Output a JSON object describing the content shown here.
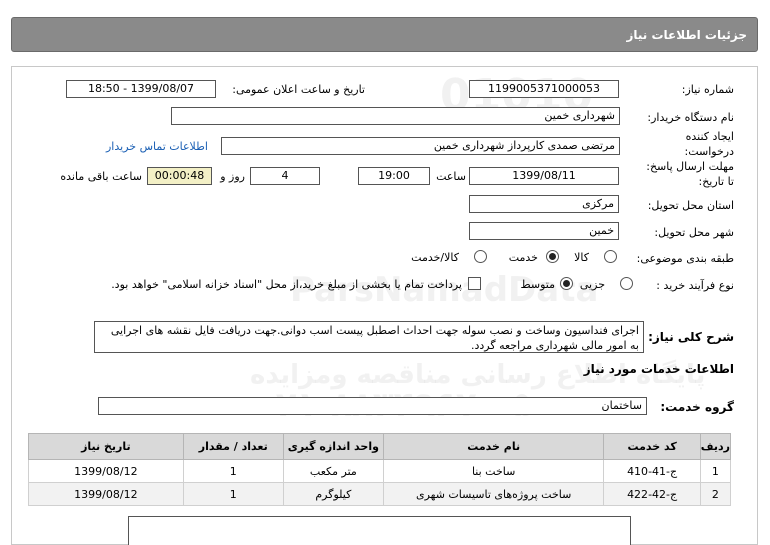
{
  "header": {
    "title": "جزئیات اطلاعات نیاز"
  },
  "form": {
    "need_number_label": "شماره نیاز:",
    "need_number": "1199005371000053",
    "announce_label": "تاریخ و ساعت اعلان عمومی:",
    "announce_value": "1399/08/07 - 18:50",
    "buyer_label": "نام دستگاه خریدار:",
    "buyer_value": "شهرداری خمین",
    "creator_label_1": "ایجاد کننده",
    "creator_label_2": "درخواست:",
    "creator_value": "مرتضی صمدی کارپرداز شهرداری خمین",
    "contact_link": "اطلاعات تماس خریدار",
    "deadline_label_1": "مهلت ارسال پاسخ:",
    "deadline_label_2": "تا تاریخ:",
    "deadline_date": "1399/08/11",
    "time_label": "ساعت",
    "deadline_time": "19:00",
    "days_value": "4",
    "days_label": "روز و",
    "remaining_time": "00:00:48",
    "remaining_label": "ساعت باقی مانده",
    "province_label": "استان محل تحویل:",
    "province_value": "مرکزی",
    "city_label": "شهر محل تحویل:",
    "city_value": "خمین",
    "category_label": "طبقه بندی موضوعی:",
    "category_options": [
      "کالا",
      "خدمت",
      "کالا/خدمت"
    ],
    "process_label": "نوع فرآیند خرید :",
    "process_options": [
      "جزیی",
      "متوسط"
    ],
    "payment_note": "پرداخت تمام یا بخشی از مبلغ خرید،از محل \"اسناد خزانه اسلامی\" خواهد بود.",
    "description_label": "شرح کلی نیاز:",
    "description": "اجرای فنداسیون وساخت و نصب سوله جهت احداث اصطبل پیست اسب دوانی.جهت دریافت فایل نقشه های اجرایی به امور مالی شهرداری مراجعه گردد.",
    "services_heading": "اطلاعات خدمات مورد نیاز",
    "service_group_label": "گروه خدمت:",
    "service_group_value": "ساختمان"
  },
  "table": {
    "headers": [
      "ردیف",
      "کد خدمت",
      "نام خدمت",
      "واحد اندازه گیری",
      "تعداد / مقدار",
      "تاریخ نیاز"
    ],
    "rows": [
      [
        "1",
        "ج-41-410",
        "ساخت بنا",
        "متر مکعب",
        "1",
        "1399/08/12"
      ],
      [
        "2",
        "ج-42-422",
        "ساخت پروژه‌های تاسیسات شهری",
        "کیلوگرم",
        "1",
        "1399/08/12"
      ]
    ]
  },
  "watermark": {
    "line1": "ParsNamadData",
    "line2": "پایگاه اطلاع رسانی مناقصه ومزایده",
    "line3": "۰۲۱-۸۸۳۴۹۶۷۰-۵"
  }
}
